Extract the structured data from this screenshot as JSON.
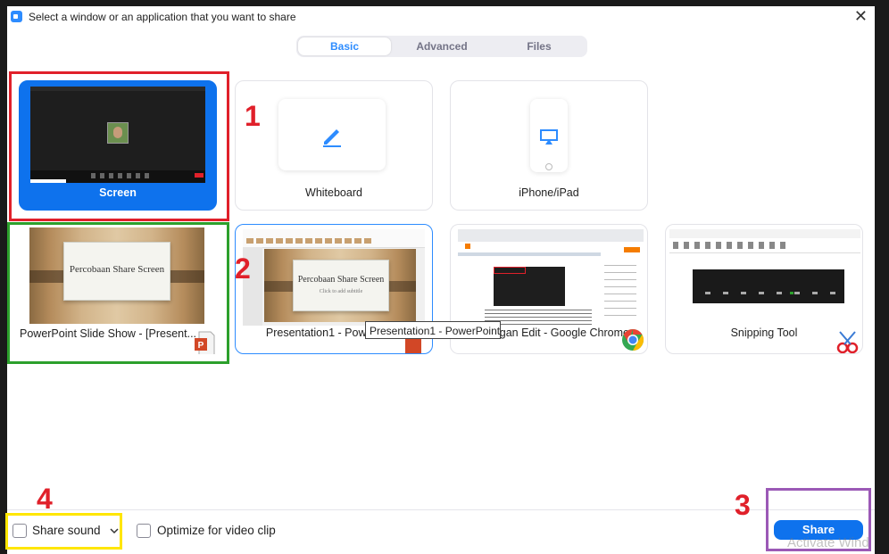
{
  "window": {
    "title": "Select a window or an application that you want to share",
    "close_glyph": "✕"
  },
  "tabs": [
    {
      "label": "Basic",
      "active": true
    },
    {
      "label": "Advanced",
      "active": false
    },
    {
      "label": "Files",
      "active": false
    }
  ],
  "tiles": {
    "screen": {
      "label": "Screen"
    },
    "whiteboard": {
      "label": "Whiteboard",
      "icon": "pen-icon"
    },
    "iphone": {
      "label": "iPhone/iPad",
      "icon": "airplay-icon"
    },
    "ppt_slideshow": {
      "label": "PowerPoint Slide Show - [Present...",
      "slide_title": "Percobaan Share Screen",
      "icon": "powerpoint-file-icon"
    },
    "ppt_presentation": {
      "label": "Presentation1 - PowerPoint",
      "slide_title": "Percobaan Share Screen",
      "slide_subtitle": "Click to add subtitle",
      "icon": "powerpoint-icon"
    },
    "chrome": {
      "label": "Postingan Edit - Google Chrome",
      "icon": "chrome-icon"
    },
    "snipping": {
      "label": "Snipping Tool",
      "icon": "snipping-tool-icon"
    }
  },
  "tooltip": "Presentation1 - PowerPoint",
  "footer": {
    "share_sound": "Share sound",
    "share_sound_checked": false,
    "optimize": "Optimize for video clip",
    "optimize_checked": false,
    "share_button": "Share"
  },
  "annotations": {
    "n1": "1",
    "n2": "2",
    "n3": "3",
    "n4": "4"
  },
  "watermark": "Activate Wind",
  "colors": {
    "accent": "#0e72ed",
    "red_annotation": "#e0202a",
    "green_annotation": "#2ca02c",
    "yellow_annotation": "#ffe600",
    "purple_annotation": "#9b59b6"
  }
}
